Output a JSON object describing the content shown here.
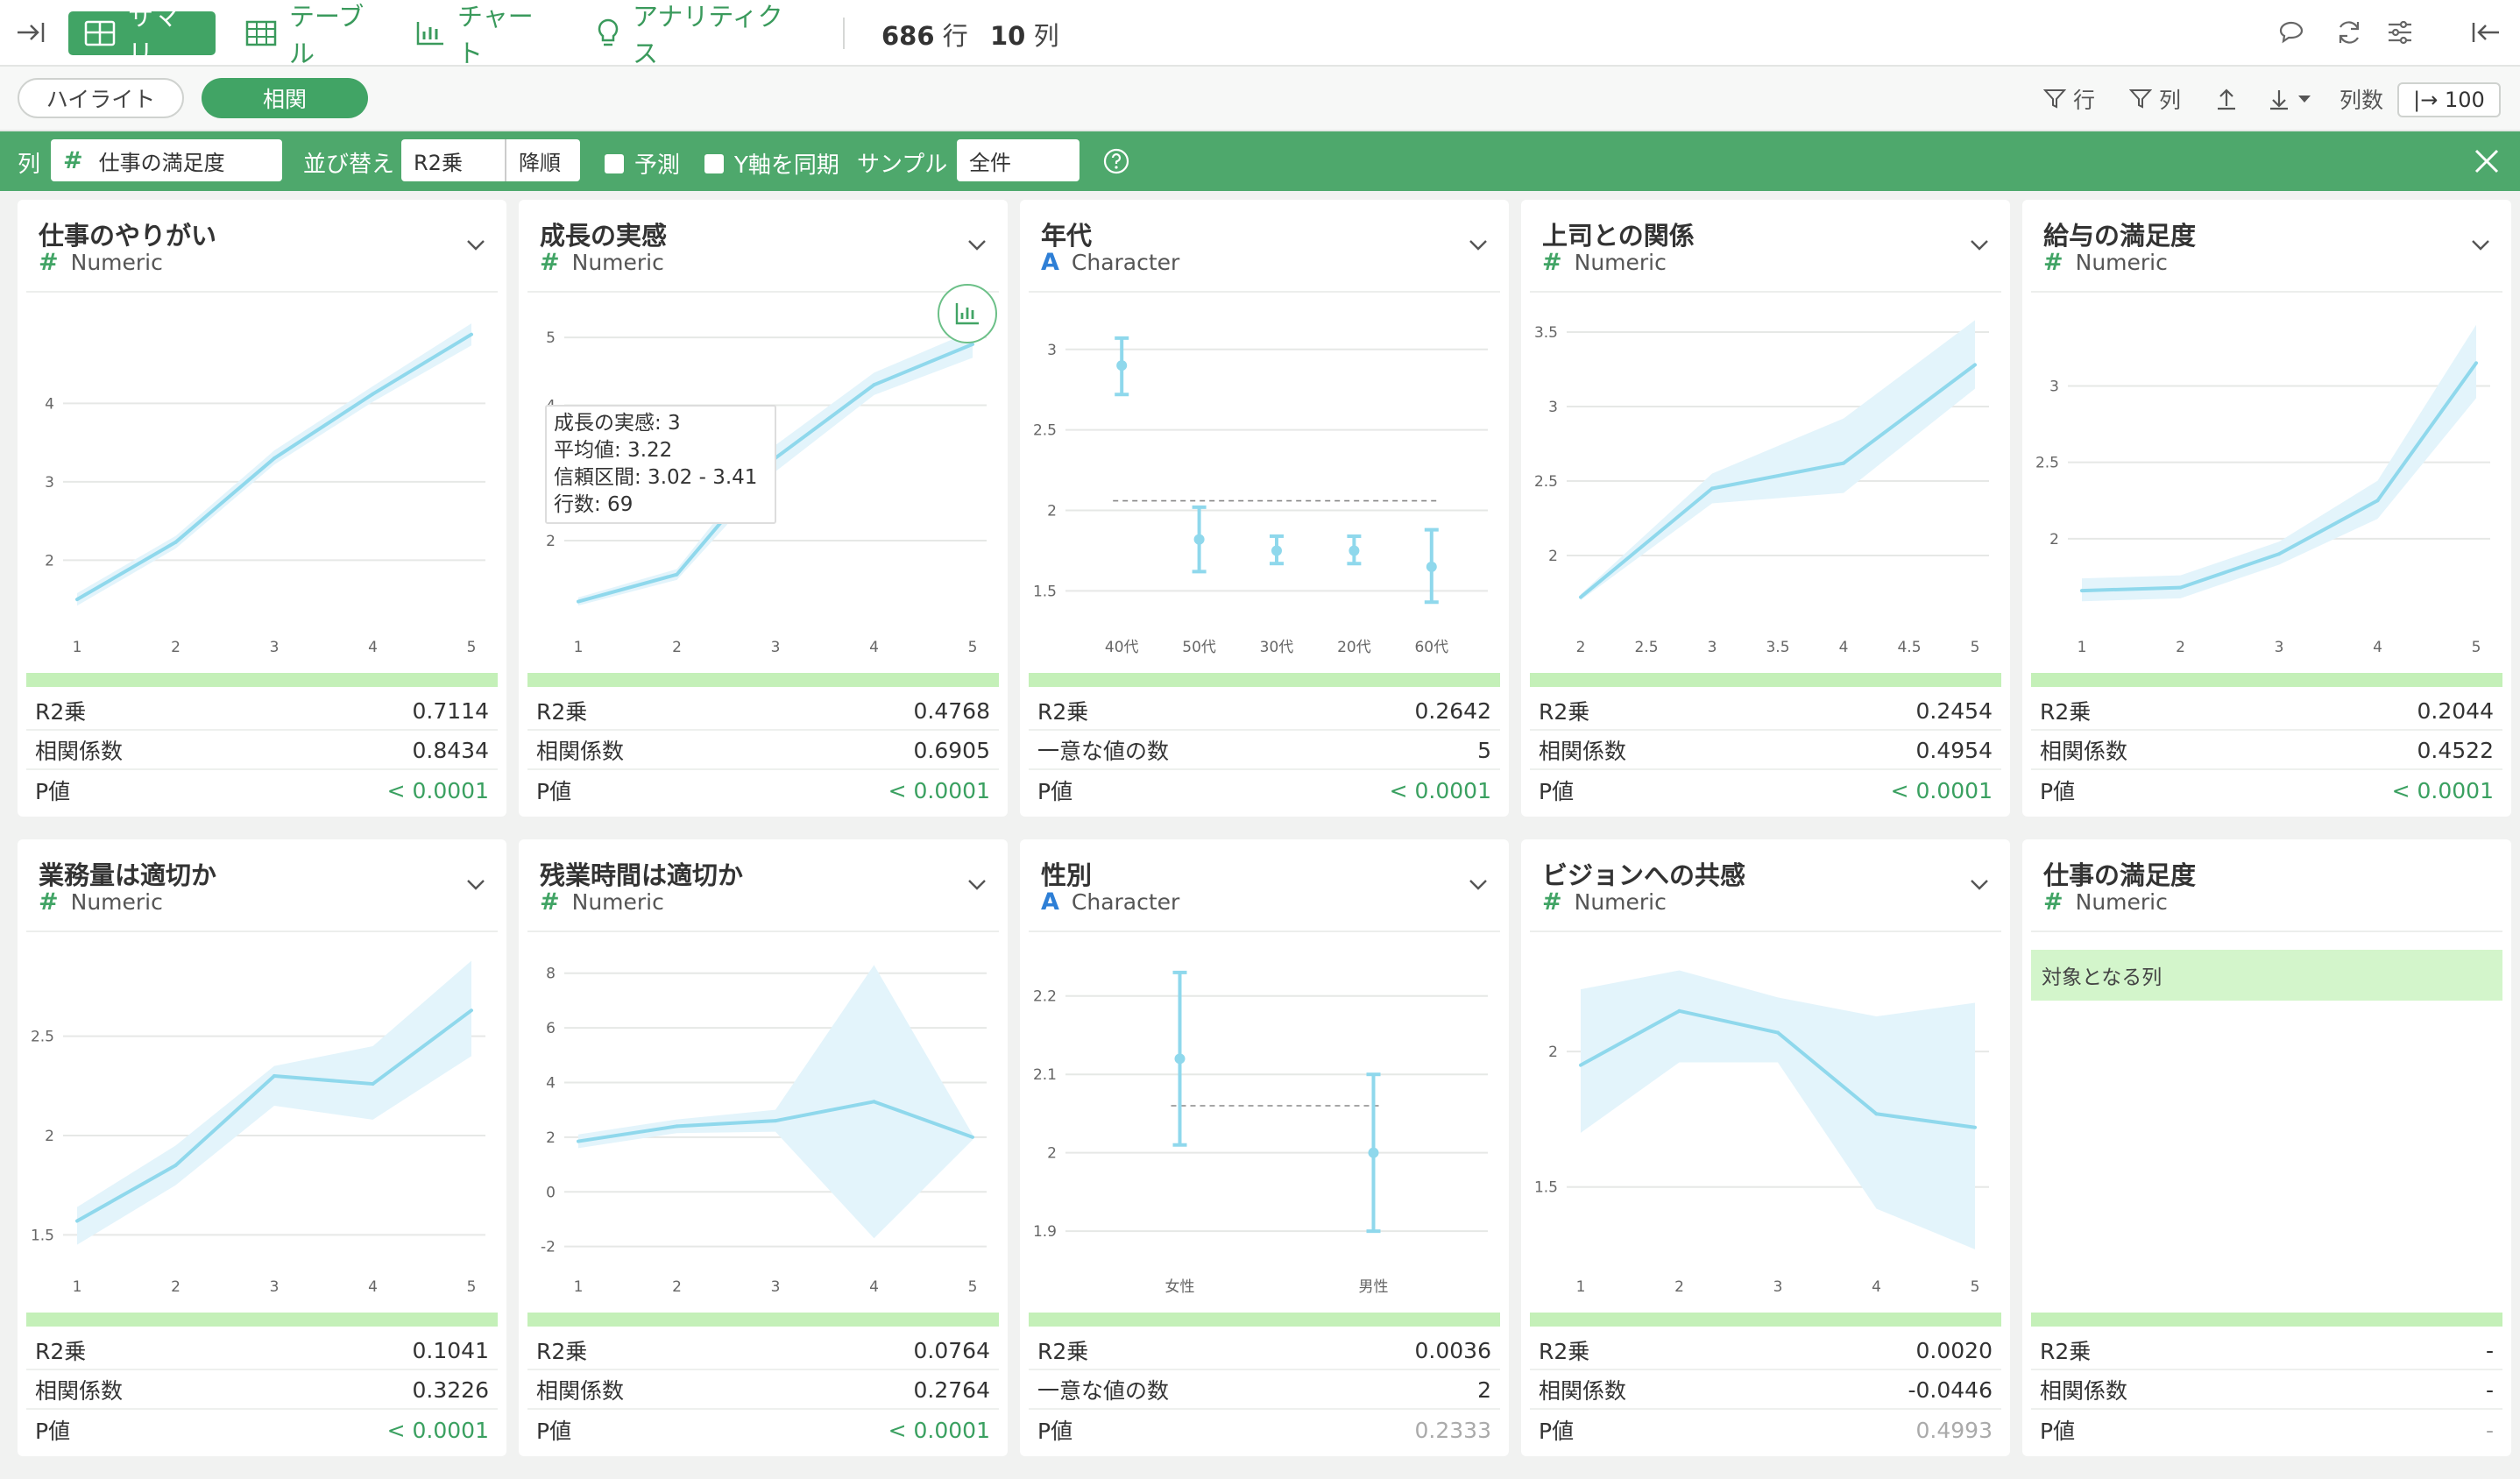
{
  "toolbar": {
    "tabs": [
      {
        "label": "サマリ",
        "icon": "grid-icon",
        "active": true
      },
      {
        "label": "テーブル",
        "icon": "table-icon"
      },
      {
        "label": "チャート",
        "icon": "bar-chart-icon"
      },
      {
        "label": "アナリティクス",
        "icon": "lightbulb-icon"
      }
    ],
    "rows": "686",
    "rows_unit": "行",
    "cols": "10",
    "cols_unit": "列"
  },
  "subbar": {
    "highlight": "ハイライト",
    "correlation": "相関",
    "filter_row": "行",
    "filter_col": "列",
    "colcount_label": "列数",
    "colcount_value": "|→ 100"
  },
  "filterbar": {
    "col_label": "列",
    "col_value": "仕事の満足度",
    "sort_label": "並び替え",
    "sort_by": "R2乗",
    "sort_order": "降順",
    "predict": "予測",
    "sync_y": "Y軸を同期",
    "sample_label": "サンプル",
    "sample_value": "全件"
  },
  "colors": {
    "accent": "#41a465",
    "line": "#8fd8ec",
    "band": "#e3f4fb",
    "strip": "#c4f0b8"
  },
  "cards": [
    {
      "title": "仕事のやりがい",
      "type": "Numeric",
      "type_icon": "#",
      "stats": [
        {
          "label": "R2乗",
          "value": "0.7114"
        },
        {
          "label": "相関係数",
          "value": "0.8434"
        },
        {
          "label": "P値",
          "value": "< 0.0001"
        }
      ]
    },
    {
      "title": "成長の実感",
      "type": "Numeric",
      "type_icon": "#",
      "tooltip": [
        "成長の実感: 3",
        "平均値: 3.22",
        "信頼区間: 3.02 - 3.41",
        "行数: 69"
      ],
      "stats": [
        {
          "label": "R2乗",
          "value": "0.4768"
        },
        {
          "label": "相関係数",
          "value": "0.6905"
        },
        {
          "label": "P値",
          "value": "< 0.0001"
        }
      ]
    },
    {
      "title": "年代",
      "type": "Character",
      "type_icon": "A",
      "stats": [
        {
          "label": "R2乗",
          "value": "0.2642"
        },
        {
          "label": "一意な値の数",
          "value": "5"
        },
        {
          "label": "P値",
          "value": "< 0.0001"
        }
      ]
    },
    {
      "title": "上司との関係",
      "type": "Numeric",
      "type_icon": "#",
      "stats": [
        {
          "label": "R2乗",
          "value": "0.2454"
        },
        {
          "label": "相関係数",
          "value": "0.4954"
        },
        {
          "label": "P値",
          "value": "< 0.0001"
        }
      ]
    },
    {
      "title": "給与の満足度",
      "type": "Numeric",
      "type_icon": "#",
      "stats": [
        {
          "label": "R2乗",
          "value": "0.2044"
        },
        {
          "label": "相関係数",
          "value": "0.4522"
        },
        {
          "label": "P値",
          "value": "< 0.0001"
        }
      ]
    },
    {
      "title": "業務量は適切か",
      "type": "Numeric",
      "type_icon": "#",
      "stats": [
        {
          "label": "R2乗",
          "value": "0.1041"
        },
        {
          "label": "相関係数",
          "value": "0.3226"
        },
        {
          "label": "P値",
          "value": "< 0.0001"
        }
      ]
    },
    {
      "title": "残業時間は適切か",
      "type": "Numeric",
      "type_icon": "#",
      "stats": [
        {
          "label": "R2乗",
          "value": "0.0764"
        },
        {
          "label": "相関係数",
          "value": "0.2764"
        },
        {
          "label": "P値",
          "value": "< 0.0001"
        }
      ]
    },
    {
      "title": "性別",
      "type": "Character",
      "type_icon": "A",
      "stats": [
        {
          "label": "R2乗",
          "value": "0.0036"
        },
        {
          "label": "一意な値の数",
          "value": "2"
        },
        {
          "label": "P値",
          "value": "0.2333"
        }
      ]
    },
    {
      "title": "ビジョンへの共感",
      "type": "Numeric",
      "type_icon": "#",
      "stats": [
        {
          "label": "R2乗",
          "value": "0.0020"
        },
        {
          "label": "相関係数",
          "value": "-0.0446"
        },
        {
          "label": "P値",
          "value": "0.4993"
        }
      ]
    },
    {
      "title": "仕事の満足度",
      "type": "Numeric",
      "type_icon": "#",
      "target_label": "対象となる列",
      "stats": [
        {
          "label": "R2乗",
          "value": "-"
        },
        {
          "label": "相関係数",
          "value": "-"
        },
        {
          "label": "P値",
          "value": "-"
        }
      ]
    }
  ],
  "chart_data": [
    {
      "type": "line",
      "x_ticks": [
        "1",
        "2",
        "3",
        "4",
        "5"
      ],
      "y_ticks": [
        "2",
        "3",
        "4"
      ],
      "x": [
        1,
        2,
        3,
        4,
        5
      ],
      "y": [
        1.5,
        2.23,
        3.3,
        4.12,
        4.88
      ],
      "band_low": [
        1.42,
        2.15,
        3.22,
        4.02,
        4.74
      ],
      "band_high": [
        1.58,
        2.31,
        3.4,
        4.22,
        5.02
      ],
      "xlim": [
        1,
        5
      ],
      "ylim": [
        1.3,
        5.1
      ]
    },
    {
      "type": "line",
      "x_ticks": [
        "1",
        "2",
        "3",
        "4",
        "5"
      ],
      "y_ticks": [
        "2",
        "4",
        "5"
      ],
      "x": [
        1,
        2,
        3,
        4,
        5
      ],
      "y": [
        1.1,
        1.5,
        3.22,
        4.3,
        4.9
      ],
      "band_low": [
        1.04,
        1.42,
        3.02,
        4.15,
        4.7
      ],
      "band_high": [
        1.16,
        1.58,
        3.41,
        4.48,
        5.1
      ],
      "xlim": [
        1,
        5
      ],
      "ylim": [
        0.9,
        5.3
      ]
    },
    {
      "type": "errorbar",
      "categories": [
        "40代",
        "50代",
        "30代",
        "20代",
        "60代"
      ],
      "y_ticks": [
        "1.5",
        "2",
        "2.5",
        "3"
      ],
      "values": [
        2.9,
        1.82,
        1.75,
        1.75,
        1.65
      ],
      "err_low": [
        2.72,
        1.62,
        1.67,
        1.67,
        1.43
      ],
      "err_high": [
        3.07,
        2.02,
        1.84,
        1.84,
        1.88
      ],
      "mean_line": 2.06,
      "ylim": [
        1.35,
        3.2
      ]
    },
    {
      "type": "line",
      "x_ticks": [
        "2",
        "2.5",
        "3",
        "3.5",
        "4",
        "4.5",
        "5"
      ],
      "y_ticks": [
        "2",
        "2.5",
        "3",
        "3.5"
      ],
      "x": [
        2,
        3,
        4,
        5
      ],
      "y": [
        1.72,
        2.45,
        2.62,
        3.28
      ],
      "band_low": [
        1.7,
        2.35,
        2.42,
        3.12
      ],
      "band_high": [
        1.74,
        2.55,
        2.92,
        3.58
      ],
      "xlim": [
        2,
        5
      ],
      "ylim": [
        1.6,
        3.6
      ]
    },
    {
      "type": "line",
      "x_ticks": [
        "1",
        "2",
        "3",
        "4",
        "5"
      ],
      "y_ticks": [
        "2",
        "2.5",
        "3"
      ],
      "x": [
        1,
        2,
        3,
        4,
        5
      ],
      "y": [
        1.66,
        1.68,
        1.9,
        2.25,
        3.15
      ],
      "band_low": [
        1.59,
        1.61,
        1.83,
        2.13,
        2.92
      ],
      "band_high": [
        1.74,
        1.76,
        1.98,
        2.38,
        3.4
      ],
      "xlim": [
        1,
        5
      ],
      "ylim": [
        1.5,
        3.45
      ]
    },
    {
      "type": "line",
      "x_ticks": [
        "1",
        "2",
        "3",
        "4",
        "5"
      ],
      "y_ticks": [
        "1.5",
        "2",
        "2.5"
      ],
      "x": [
        1,
        2,
        3,
        4,
        5
      ],
      "y": [
        1.57,
        1.85,
        2.3,
        2.26,
        2.63
      ],
      "band_low": [
        1.45,
        1.75,
        2.15,
        2.08,
        2.4
      ],
      "band_high": [
        1.64,
        1.95,
        2.35,
        2.45,
        2.88
      ],
      "xlim": [
        1,
        5
      ],
      "ylim": [
        1.4,
        2.9
      ]
    },
    {
      "type": "line",
      "x_ticks": [
        "1",
        "2",
        "3",
        "4",
        "5"
      ],
      "y_ticks": [
        "-2",
        "0",
        "2",
        "4",
        "6",
        "8"
      ],
      "x": [
        1,
        2,
        3,
        4,
        5
      ],
      "y": [
        1.85,
        2.4,
        2.6,
        3.3,
        2.0
      ],
      "band_low": [
        1.6,
        2.15,
        2.2,
        -1.7,
        1.9
      ],
      "band_high": [
        2.1,
        2.65,
        3.0,
        8.3,
        2.1
      ],
      "xlim": [
        1,
        5
      ],
      "ylim": [
        -2.3,
        8.6
      ]
    },
    {
      "type": "errorbar",
      "categories": [
        "女性",
        "男性"
      ],
      "y_ticks": [
        "1.9",
        "2",
        "2.1",
        "2.2"
      ],
      "values": [
        2.12,
        2.0
      ],
      "err_low": [
        2.01,
        1.9
      ],
      "err_high": [
        2.23,
        2.1
      ],
      "mean_line": 2.06,
      "ylim": [
        1.87,
        2.25
      ]
    },
    {
      "type": "line",
      "x_ticks": [
        "1",
        "2",
        "3",
        "4",
        "5"
      ],
      "y_ticks": [
        "1.5",
        "2"
      ],
      "x": [
        1,
        2,
        3,
        4,
        5
      ],
      "y": [
        1.95,
        2.15,
        2.07,
        1.77,
        1.72
      ],
      "band_low": [
        1.7,
        1.96,
        1.96,
        1.42,
        1.27
      ],
      "band_high": [
        2.23,
        2.3,
        2.2,
        2.13,
        2.18
      ],
      "xlim": [
        1,
        5
      ],
      "ylim": [
        1.25,
        2.35
      ]
    }
  ]
}
